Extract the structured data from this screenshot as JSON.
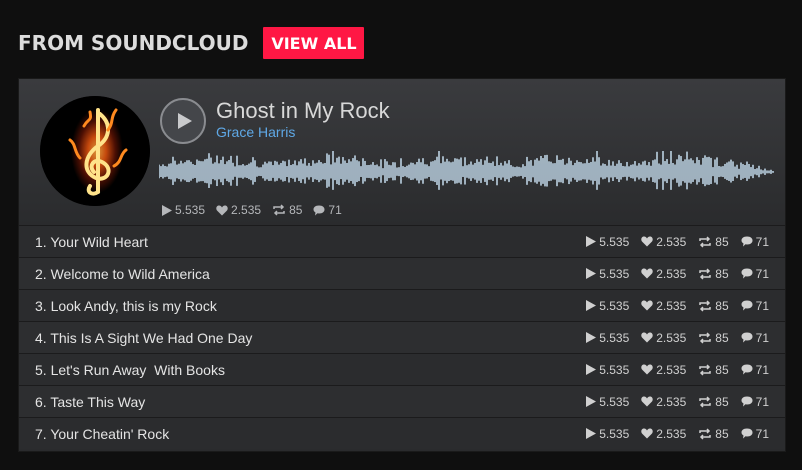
{
  "header": {
    "title": "FROM SOUNDCLOUD",
    "view_all_label": "VIEW ALL"
  },
  "player": {
    "track_title": "Ghost in My Rock",
    "artist": "Grace Harris",
    "stats": {
      "plays": "5.535",
      "likes": "2.535",
      "reposts": "85",
      "comments": "71"
    }
  },
  "tracks": [
    {
      "title": "1. Your Wild Heart",
      "plays": "5.535",
      "likes": "2.535",
      "reposts": "85",
      "comments": "71"
    },
    {
      "title": "2. Welcome to Wild America",
      "plays": "5.535",
      "likes": "2.535",
      "reposts": "85",
      "comments": "71"
    },
    {
      "title": "3. Look Andy, this is my Rock",
      "plays": "5.535",
      "likes": "2.535",
      "reposts": "85",
      "comments": "71"
    },
    {
      "title": "4. This Is A Sight We Had One Day",
      "plays": "5.535",
      "likes": "2.535",
      "reposts": "85",
      "comments": "71"
    },
    {
      "title": "5. Let's Run Away  With Books",
      "plays": "5.535",
      "likes": "2.535",
      "reposts": "85",
      "comments": "71"
    },
    {
      "title": "6. Taste This Way",
      "plays": "5.535",
      "likes": "2.535",
      "reposts": "85",
      "comments": "71"
    },
    {
      "title": "7. Your Cheatin' Rock",
      "plays": "5.535",
      "likes": "2.535",
      "reposts": "85",
      "comments": "71"
    }
  ],
  "colors": {
    "accent": "#ff1744",
    "artist_link": "#5fa8e6",
    "waveform": "#cfe8fb"
  },
  "icons": {
    "play_button": "play-icon",
    "plays": "play-count-icon",
    "likes": "heart-icon",
    "reposts": "repost-icon",
    "comments": "comment-icon"
  }
}
